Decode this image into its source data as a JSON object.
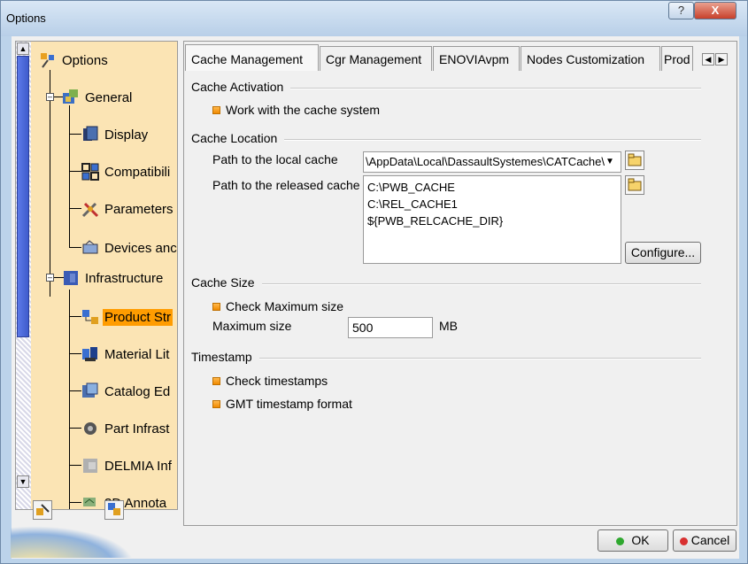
{
  "window": {
    "title": "Options",
    "help_label": "?",
    "close_label": "X"
  },
  "tree": {
    "root": "Options",
    "items": [
      {
        "label": "General",
        "icon": "general-icon"
      },
      {
        "label": "Display",
        "icon": "display-icon"
      },
      {
        "label": "Compatibili",
        "icon": "compatibility-icon"
      },
      {
        "label": "Parameters",
        "icon": "parameters-icon"
      },
      {
        "label": "Devices anc",
        "icon": "devices-icon"
      },
      {
        "label": "Infrastructure",
        "icon": "infrastructure-icon"
      },
      {
        "label": "Product Str",
        "icon": "product-structure-icon",
        "selected": true
      },
      {
        "label": "Material Lit",
        "icon": "material-library-icon"
      },
      {
        "label": "Catalog Ed",
        "icon": "catalog-editor-icon"
      },
      {
        "label": "Part Infrast",
        "icon": "part-infrastructure-icon"
      },
      {
        "label": "DELMIA Inf",
        "icon": "delmia-icon"
      },
      {
        "label": "3D Annota",
        "icon": "annotation-icon"
      }
    ]
  },
  "tabs": [
    "Cache Management",
    "Cgr Management",
    "ENOVIAvpm",
    "Nodes Customization",
    "Prod"
  ],
  "cache_activation": {
    "title": "Cache Activation",
    "work_with_cache": "Work with the cache system"
  },
  "cache_location": {
    "title": "Cache Location",
    "local_label": "Path to the local cache",
    "local_value": "\\AppData\\Local\\DassaultSystemes\\CATCache\\",
    "released_label": "Path to the released cache",
    "released_paths": [
      "C:\\PWB_CACHE",
      "C:\\REL_CACHE1",
      "${PWB_RELCACHE_DIR}"
    ],
    "configure_label": "Configure..."
  },
  "cache_size": {
    "title": "Cache Size",
    "check_max": "Check Maximum size",
    "max_label": "Maximum size",
    "max_value": "500",
    "unit": "MB"
  },
  "timestamp": {
    "title": "Timestamp",
    "check_timestamps": "Check timestamps",
    "gmt_format": "GMT timestamp format"
  },
  "buttons": {
    "ok": "OK",
    "cancel": "Cancel"
  },
  "colors": {
    "selection": "#ff9c00",
    "tree_bg": "#fbe4b4",
    "checkbox": "#f08a00"
  }
}
